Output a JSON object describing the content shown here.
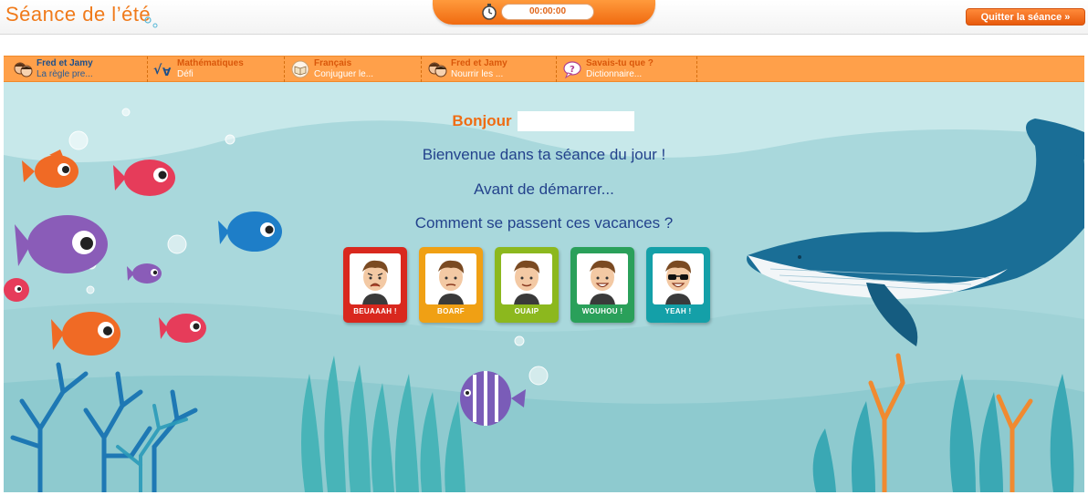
{
  "header": {
    "title": "Séance de l’été",
    "timer": "00:00:00",
    "quit_label": "Quitter la séance »"
  },
  "activities": [
    {
      "title": "Fred et Jamy",
      "subtitle": "La règle pre...",
      "icon": "fred-jamy-icon"
    },
    {
      "title": "Mathématiques",
      "subtitle": "Défi",
      "icon": "math-icon"
    },
    {
      "title": "Français",
      "subtitle": "Conjuguer le...",
      "icon": "book-icon"
    },
    {
      "title": "Fred et Jamy",
      "subtitle": "Nourrir les ...",
      "icon": "fred-jamy-icon"
    },
    {
      "title": "Savais-tu que ?",
      "subtitle": "Dictionnaire...",
      "icon": "question-bubble-icon"
    }
  ],
  "welcome": {
    "greeting": "Bonjour",
    "line1": "Bienvenue dans ta séance du jour !",
    "line2": "Avant de démarrer...",
    "question": "Comment se passent ces vacances ?"
  },
  "moods": [
    {
      "label": "BEUAAAH !",
      "color": "#d9281e"
    },
    {
      "label": "BOARF",
      "color": "#f0a014"
    },
    {
      "label": "OUAIP",
      "color": "#8cb81e"
    },
    {
      "label": "WOUHOU !",
      "color": "#2aa05a"
    },
    {
      "label": "YEAH !",
      "color": "#14a0a8"
    }
  ],
  "colors": {
    "accent": "#f07a1a",
    "text_blue": "#23428c",
    "water": "#a9d8dc"
  }
}
